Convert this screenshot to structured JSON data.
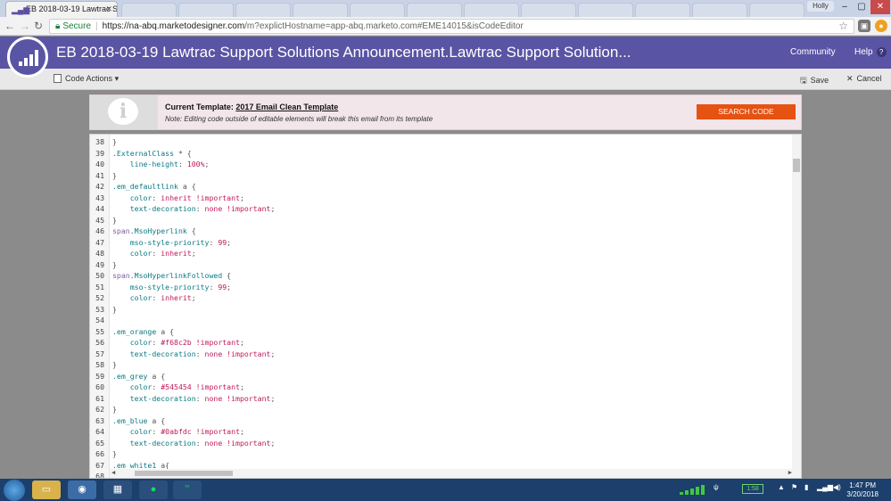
{
  "browser": {
    "tab_title": "EB 2018-03-19 Lawtrac S",
    "user_badge": "Holly",
    "url_secure_label": "Secure",
    "url_host": "https://na-abq.marketodesigner.com",
    "url_path": "/m?explictHostname=app-abq.marketo.com#EME14015&isCodeEditor"
  },
  "header": {
    "title": "EB 2018-03-19 Lawtrac Support Solutions Announcement.Lawtrac Support Solution...",
    "community_label": "Community",
    "help_label": "Help"
  },
  "toolbar": {
    "code_actions_label": "Code Actions",
    "save_label": "Save",
    "cancel_label": "Cancel"
  },
  "notice": {
    "title_prefix": "Current Template:",
    "template_name": "2017 Email Clean Template",
    "note": "Note: Editing code outside of editable elements will break this email from its template",
    "search_button": "SEARCH CODE"
  },
  "editor": {
    "lines": [
      {
        "n": "38",
        "indent": "",
        "parts": [
          [
            "punc",
            "}"
          ]
        ]
      },
      {
        "n": "39",
        "indent": "",
        "parts": [
          [
            "sel",
            ".ExternalClass"
          ],
          [
            "punc",
            " * {"
          ]
        ]
      },
      {
        "n": "40",
        "indent": "    ",
        "parts": [
          [
            "prop",
            "line-height"
          ],
          [
            "punc",
            ": "
          ],
          [
            "val",
            "100%"
          ],
          [
            "punc",
            ";"
          ]
        ]
      },
      {
        "n": "41",
        "indent": "",
        "parts": [
          [
            "punc",
            "}"
          ]
        ]
      },
      {
        "n": "42",
        "indent": "",
        "parts": [
          [
            "sel",
            ".em_defaultlink"
          ],
          [
            "punc",
            " a {"
          ]
        ]
      },
      {
        "n": "43",
        "indent": "    ",
        "parts": [
          [
            "prop",
            "color"
          ],
          [
            "punc",
            ": "
          ],
          [
            "val",
            "inherit !important"
          ],
          [
            "punc",
            ";"
          ]
        ]
      },
      {
        "n": "44",
        "indent": "    ",
        "parts": [
          [
            "prop",
            "text-decoration"
          ],
          [
            "punc",
            ": "
          ],
          [
            "val",
            "none !important"
          ],
          [
            "punc",
            ";"
          ]
        ]
      },
      {
        "n": "45",
        "indent": "",
        "parts": [
          [
            "punc",
            "}"
          ]
        ]
      },
      {
        "n": "46",
        "indent": "",
        "parts": [
          [
            "tag",
            "span"
          ],
          [
            "sel",
            ".MsoHyperlink"
          ],
          [
            "punc",
            " {"
          ]
        ]
      },
      {
        "n": "47",
        "indent": "    ",
        "parts": [
          [
            "prop",
            "mso-style-priority"
          ],
          [
            "punc",
            ": "
          ],
          [
            "val",
            "99"
          ],
          [
            "punc",
            ";"
          ]
        ]
      },
      {
        "n": "48",
        "indent": "    ",
        "parts": [
          [
            "prop",
            "color"
          ],
          [
            "punc",
            ": "
          ],
          [
            "val",
            "inherit"
          ],
          [
            "punc",
            ";"
          ]
        ]
      },
      {
        "n": "49",
        "indent": "",
        "parts": [
          [
            "punc",
            "}"
          ]
        ]
      },
      {
        "n": "50",
        "indent": "",
        "parts": [
          [
            "tag",
            "span"
          ],
          [
            "sel",
            ".MsoHyperlinkFollowed"
          ],
          [
            "punc",
            " {"
          ]
        ]
      },
      {
        "n": "51",
        "indent": "    ",
        "parts": [
          [
            "prop",
            "mso-style-priority"
          ],
          [
            "punc",
            ": "
          ],
          [
            "val",
            "99"
          ],
          [
            "punc",
            ";"
          ]
        ]
      },
      {
        "n": "52",
        "indent": "    ",
        "parts": [
          [
            "prop",
            "color"
          ],
          [
            "punc",
            ": "
          ],
          [
            "val",
            "inherit"
          ],
          [
            "punc",
            ";"
          ]
        ]
      },
      {
        "n": "53",
        "indent": "",
        "parts": [
          [
            "punc",
            "}"
          ]
        ]
      },
      {
        "n": "54",
        "indent": "",
        "parts": []
      },
      {
        "n": "55",
        "indent": "",
        "parts": [
          [
            "sel",
            ".em_orange"
          ],
          [
            "punc",
            " a {"
          ]
        ]
      },
      {
        "n": "56",
        "indent": "    ",
        "parts": [
          [
            "prop",
            "color"
          ],
          [
            "punc",
            ": "
          ],
          [
            "val",
            "#f68c2b !important"
          ],
          [
            "punc",
            ";"
          ]
        ]
      },
      {
        "n": "57",
        "indent": "    ",
        "parts": [
          [
            "prop",
            "text-decoration"
          ],
          [
            "punc",
            ": "
          ],
          [
            "val",
            "none !important"
          ],
          [
            "punc",
            ";"
          ]
        ]
      },
      {
        "n": "58",
        "indent": "",
        "parts": [
          [
            "punc",
            "}"
          ]
        ]
      },
      {
        "n": "59",
        "indent": "",
        "parts": [
          [
            "sel",
            ".em_grey"
          ],
          [
            "punc",
            " a {"
          ]
        ]
      },
      {
        "n": "60",
        "indent": "    ",
        "parts": [
          [
            "prop",
            "color"
          ],
          [
            "punc",
            ": "
          ],
          [
            "val",
            "#545454 !important"
          ],
          [
            "punc",
            ";"
          ]
        ]
      },
      {
        "n": "61",
        "indent": "    ",
        "parts": [
          [
            "prop",
            "text-decoration"
          ],
          [
            "punc",
            ": "
          ],
          [
            "val",
            "none !important"
          ],
          [
            "punc",
            ";"
          ]
        ]
      },
      {
        "n": "62",
        "indent": "",
        "parts": [
          [
            "punc",
            "}"
          ]
        ]
      },
      {
        "n": "63",
        "indent": "",
        "parts": [
          [
            "sel",
            ".em_blue"
          ],
          [
            "punc",
            " a {"
          ]
        ]
      },
      {
        "n": "64",
        "indent": "    ",
        "parts": [
          [
            "prop",
            "color"
          ],
          [
            "punc",
            ": "
          ],
          [
            "val",
            "#0abfdc !important"
          ],
          [
            "punc",
            ";"
          ]
        ]
      },
      {
        "n": "65",
        "indent": "    ",
        "parts": [
          [
            "prop",
            "text-decoration"
          ],
          [
            "punc",
            ": "
          ],
          [
            "val",
            "none !important"
          ],
          [
            "punc",
            ";"
          ]
        ]
      },
      {
        "n": "66",
        "indent": "",
        "parts": [
          [
            "punc",
            "}"
          ]
        ]
      },
      {
        "n": "67",
        "indent": "",
        "parts": [
          [
            "sel",
            ".em_white1"
          ],
          [
            "punc",
            " a{"
          ]
        ]
      },
      {
        "n": "68",
        "indent": "",
        "parts": []
      }
    ]
  },
  "taskbar": {
    "battery": "1:58",
    "time": "1:47 PM",
    "date": "3/20/2018"
  },
  "colors": {
    "brand": "#5a54a4",
    "accent": "#e55212"
  }
}
